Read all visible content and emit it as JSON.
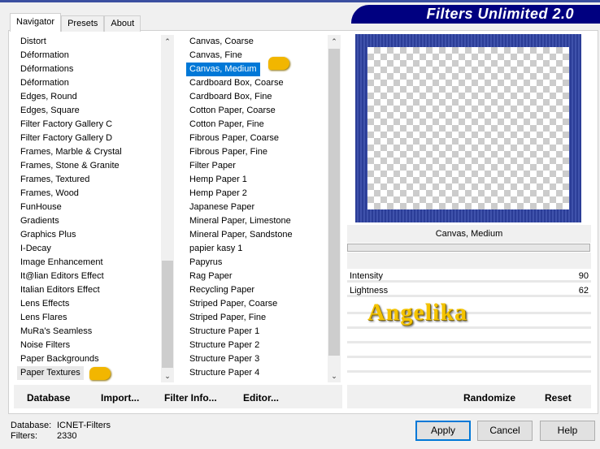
{
  "app": {
    "title": "Filters Unlimited 2.0"
  },
  "tabs": [
    "Navigator",
    "Presets",
    "About"
  ],
  "categories": [
    "Distort",
    "Déformation",
    "Déformations",
    "Déformation",
    "Edges, Round",
    "Edges, Square",
    "Filter Factory Gallery C",
    "Filter Factory Gallery D",
    "Frames, Marble & Crystal",
    "Frames, Stone & Granite",
    "Frames, Textured",
    "Frames, Wood",
    "FunHouse",
    "Gradients",
    "Graphics Plus",
    "I-Decay",
    "Image Enhancement",
    "It@lian Editors Effect",
    "Italian Editors Effect",
    "Lens Effects",
    "Lens Flares",
    "MuRa's Seamless",
    "Noise Filters",
    "Paper Backgrounds",
    "Paper Textures"
  ],
  "selected_category": "Paper Textures",
  "filters": [
    "Canvas, Coarse",
    "Canvas, Fine",
    "Canvas, Medium",
    "Cardboard Box, Coarse",
    "Cardboard Box, Fine",
    "Cotton Paper, Coarse",
    "Cotton Paper, Fine",
    "Fibrous Paper, Coarse",
    "Fibrous Paper, Fine",
    "Filter Paper",
    "Hemp Paper 1",
    "Hemp Paper 2",
    "Japanese Paper",
    "Mineral Paper, Limestone",
    "Mineral Paper, Sandstone",
    "papier kasy 1",
    "Papyrus",
    "Rag Paper",
    "Recycling Paper",
    "Striped Paper, Coarse",
    "Striped Paper, Fine",
    "Structure Paper 1",
    "Structure Paper 2",
    "Structure Paper 3",
    "Structure Paper 4"
  ],
  "selected_filter": "Canvas, Medium",
  "preview": {
    "filter_name": "Canvas, Medium"
  },
  "params": [
    {
      "label": "Intensity",
      "value": 90
    },
    {
      "label": "Lightness",
      "value": 62
    }
  ],
  "watermark": "Angelika",
  "left_buttons": [
    "Database",
    "Import...",
    "Filter Info...",
    "Editor..."
  ],
  "right_buttons": [
    "Randomize",
    "Reset"
  ],
  "status": {
    "database_label": "Database:",
    "database_value": "ICNET-Filters",
    "filters_label": "Filters:",
    "filters_value": "2330"
  },
  "dialog_buttons": {
    "apply": "Apply",
    "cancel": "Cancel",
    "help": "Help"
  }
}
